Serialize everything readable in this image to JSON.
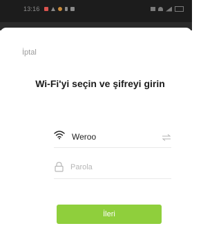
{
  "status_bar": {
    "time": "13:16",
    "icons": [
      "record-indicator-icon",
      "warning-icon",
      "app-notification-icon",
      "download-icon",
      "gallery-icon",
      "vibrate-icon",
      "wifi-icon",
      "signal-icon",
      "battery-icon"
    ]
  },
  "header": {
    "cancel_label": "İptal",
    "title": "Wi-Fi'yi seçin ve şifreyi girin"
  },
  "wifi": {
    "ssid": "Weroo"
  },
  "password": {
    "placeholder": "Parola",
    "value": ""
  },
  "actions": {
    "next_label": "İleri"
  },
  "colors": {
    "accent": "#8fcf3c",
    "status_bar": "#1c1c1c",
    "text_primary": "#1b1b1b",
    "text_secondary": "#9a9a9a"
  }
}
